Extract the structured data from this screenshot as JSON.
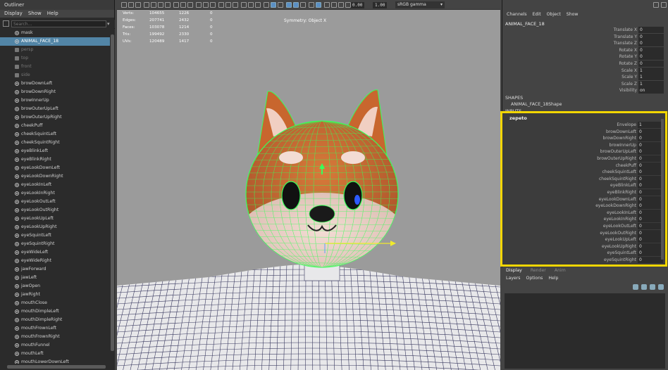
{
  "outliner": {
    "title": "Outliner",
    "menu": [
      "Display",
      "Show",
      "Help"
    ],
    "search_placeholder": "Search...",
    "items": [
      {
        "label": "mask",
        "icon": "joint-icon",
        "state": "normal"
      },
      {
        "label": "ANIMAL_FACE_18",
        "icon": "joint-icon",
        "state": "selected"
      },
      {
        "label": "persp",
        "icon": "camera-icon",
        "state": "dim"
      },
      {
        "label": "top",
        "icon": "camera-icon",
        "state": "dim"
      },
      {
        "label": "front",
        "icon": "camera-icon",
        "state": "dim"
      },
      {
        "label": "side",
        "icon": "camera-icon",
        "state": "dim"
      },
      {
        "label": "browDownLeft",
        "icon": "joint-icon",
        "state": "normal"
      },
      {
        "label": "browDownRight",
        "icon": "joint-icon",
        "state": "normal"
      },
      {
        "label": "browInnerUp",
        "icon": "joint-icon",
        "state": "normal"
      },
      {
        "label": "browOuterUpLeft",
        "icon": "joint-icon",
        "state": "normal"
      },
      {
        "label": "browOuterUpRight",
        "icon": "joint-icon",
        "state": "normal"
      },
      {
        "label": "cheekPuff",
        "icon": "joint-icon",
        "state": "normal"
      },
      {
        "label": "cheekSquintLeft",
        "icon": "joint-icon",
        "state": "normal"
      },
      {
        "label": "cheekSquintRight",
        "icon": "joint-icon",
        "state": "normal"
      },
      {
        "label": "eyeBlinkLeft",
        "icon": "joint-icon",
        "state": "normal"
      },
      {
        "label": "eyeBlinkRight",
        "icon": "joint-icon",
        "state": "normal"
      },
      {
        "label": "eyeLookDownLeft",
        "icon": "joint-icon",
        "state": "normal"
      },
      {
        "label": "eyeLookDownRight",
        "icon": "joint-icon",
        "state": "normal"
      },
      {
        "label": "eyeLookInLeft",
        "icon": "joint-icon",
        "state": "normal"
      },
      {
        "label": "eyeLookInRight",
        "icon": "joint-icon",
        "state": "normal"
      },
      {
        "label": "eyeLookOutLeft",
        "icon": "joint-icon",
        "state": "normal"
      },
      {
        "label": "eyeLookOutRight",
        "icon": "joint-icon",
        "state": "normal"
      },
      {
        "label": "eyeLookUpLeft",
        "icon": "joint-icon",
        "state": "normal"
      },
      {
        "label": "eyeLookUpRight",
        "icon": "joint-icon",
        "state": "normal"
      },
      {
        "label": "eyeSquintLeft",
        "icon": "joint-icon",
        "state": "normal"
      },
      {
        "label": "eyeSquintRight",
        "icon": "joint-icon",
        "state": "normal"
      },
      {
        "label": "eyeWideLeft",
        "icon": "joint-icon",
        "state": "normal"
      },
      {
        "label": "eyeWideRight",
        "icon": "joint-icon",
        "state": "normal"
      },
      {
        "label": "jawForward",
        "icon": "joint-icon",
        "state": "normal"
      },
      {
        "label": "jawLeft",
        "icon": "joint-icon",
        "state": "normal"
      },
      {
        "label": "jawOpen",
        "icon": "joint-icon",
        "state": "normal"
      },
      {
        "label": "jawRight",
        "icon": "joint-icon",
        "state": "normal"
      },
      {
        "label": "mouthClose",
        "icon": "joint-icon",
        "state": "normal"
      },
      {
        "label": "mouthDimpleLeft",
        "icon": "joint-icon",
        "state": "normal"
      },
      {
        "label": "mouthDimpleRight",
        "icon": "joint-icon",
        "state": "normal"
      },
      {
        "label": "mouthFrownLeft",
        "icon": "joint-icon",
        "state": "normal"
      },
      {
        "label": "mouthFrownRight",
        "icon": "joint-icon",
        "state": "normal"
      },
      {
        "label": "mouthFunnel",
        "icon": "joint-icon",
        "state": "normal"
      },
      {
        "label": "mouthLeft",
        "icon": "joint-icon",
        "state": "normal"
      },
      {
        "label": "mouthLowerDownLeft",
        "icon": "joint-icon",
        "state": "normal"
      }
    ]
  },
  "toolbar": {
    "value_a": "0.00",
    "value_b": "1.00",
    "color_space": "sRGB gamma"
  },
  "hud": {
    "rows": [
      {
        "label": "Verts:",
        "a": "104655",
        "b": "1226",
        "c": "0"
      },
      {
        "label": "Edges:",
        "a": "207741",
        "b": "2432",
        "c": "0"
      },
      {
        "label": "Faces:",
        "a": "103078",
        "b": "1214",
        "c": "0"
      },
      {
        "label": "Tris:",
        "a": "199492",
        "b": "2330",
        "c": "0"
      },
      {
        "label": "UVs:",
        "a": "120489",
        "b": "1417",
        "c": "0"
      }
    ],
    "symmetry": "Symmetry: Object X"
  },
  "channels": {
    "menu": [
      "Channels",
      "Edit",
      "Object",
      "Show"
    ],
    "object_name": "ANIMAL_FACE_18",
    "transform": [
      {
        "name": "Translate X",
        "value": "0"
      },
      {
        "name": "Translate Y",
        "value": "0"
      },
      {
        "name": "Translate Z",
        "value": "0"
      },
      {
        "name": "Rotate X",
        "value": "0"
      },
      {
        "name": "Rotate Y",
        "value": "0"
      },
      {
        "name": "Rotate Z",
        "value": "0"
      },
      {
        "name": "Scale X",
        "value": "1"
      },
      {
        "name": "Scale Y",
        "value": "1"
      },
      {
        "name": "Scale Z",
        "value": "1"
      },
      {
        "name": "Visibility",
        "value": "on"
      }
    ],
    "shapes_header": "SHAPES",
    "shape_name": "ANIMAL_FACE_18Shape",
    "inputs_header": "INPUTS",
    "blendshape_node": "zepeto",
    "blendshape": [
      {
        "name": "Envelope",
        "value": "1"
      },
      {
        "name": "browDownLeft",
        "value": "0"
      },
      {
        "name": "browDownRight",
        "value": "0"
      },
      {
        "name": "browInnerUp",
        "value": "0"
      },
      {
        "name": "browOuterUpLeft",
        "value": "0"
      },
      {
        "name": "browOuterUpRight",
        "value": "0"
      },
      {
        "name": "cheekPuff",
        "value": "0"
      },
      {
        "name": "cheekSquintLeft",
        "value": "0"
      },
      {
        "name": "cheekSquintRight",
        "value": "0"
      },
      {
        "name": "eyeBlinkLeft",
        "value": "0"
      },
      {
        "name": "eyeBlinkRight",
        "value": "0"
      },
      {
        "name": "eyeLookDownLeft",
        "value": "0"
      },
      {
        "name": "eyeLookDownRight",
        "value": "0"
      },
      {
        "name": "eyeLookInLeft",
        "value": "0"
      },
      {
        "name": "eyeLookInRight",
        "value": "0"
      },
      {
        "name": "eyeLookOutLeft",
        "value": "0"
      },
      {
        "name": "eyeLookOutRight",
        "value": "0"
      },
      {
        "name": "eyeLookUpLeft",
        "value": "0"
      },
      {
        "name": "eyeLookUpRight",
        "value": "0"
      },
      {
        "name": "eyeSquintLeft",
        "value": "0"
      },
      {
        "name": "eyeSquintRight",
        "value": "0"
      }
    ]
  },
  "layers": {
    "tabs": [
      "Display",
      "Render",
      "Anim"
    ],
    "menu": [
      "Layers",
      "Options",
      "Help"
    ]
  },
  "colors": {
    "selection": "#5285a6",
    "highlight_frame": "#f2d600",
    "wire_green": "#39ff5a",
    "fur_orange": "#c8662e"
  }
}
